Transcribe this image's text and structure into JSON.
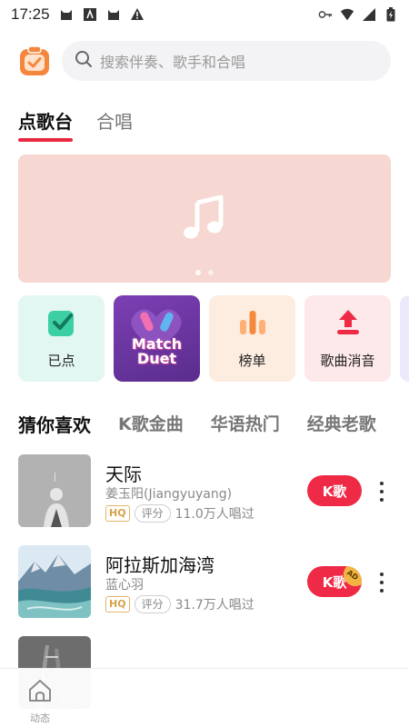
{
  "status_bar": {
    "time": "17:25",
    "left_icons": [
      "cat-icon",
      "app-a-icon",
      "cat-icon",
      "warning-icon"
    ],
    "right_icons": [
      "key-icon",
      "wifi-icon",
      "signal-icon",
      "battery-icon"
    ]
  },
  "header": {
    "search_placeholder": "搜索伴奏、歌手和合唱"
  },
  "main_tabs": [
    {
      "label": "点歌台",
      "active": true
    },
    {
      "label": "合唱",
      "active": false
    }
  ],
  "banner": {
    "icon": "music-note-icon",
    "dots": 2,
    "active_dot": 0
  },
  "quick_entries": [
    {
      "label": "已点",
      "icon": "check-icon",
      "bg": "#e3f7f2"
    },
    {
      "label": "Match Duet",
      "icon": "microphone-duet-icon",
      "bg": "#6b3aa3"
    },
    {
      "label": "榜单",
      "icon": "bar-chart-icon",
      "bg": "#fdece0"
    },
    {
      "label": "歌曲消音",
      "icon": "upload-icon",
      "bg": "#fde8ea"
    }
  ],
  "match_duet": {
    "line1": "Match",
    "line2": "Duet"
  },
  "category_tabs": [
    {
      "label": "猜你喜欢",
      "active": true
    },
    {
      "label": "K歌金曲",
      "active": false
    },
    {
      "label": "华语热门",
      "active": false
    },
    {
      "label": "经典老歌",
      "active": false
    }
  ],
  "songs": [
    {
      "title": "天际",
      "artist": "姜玉阳(Jiangyuyang)",
      "hq": "HQ",
      "rate": "评分",
      "count": "11.0万人唱过",
      "button": "K歌",
      "ad": ""
    },
    {
      "title": "阿拉斯加海湾",
      "artist": "蓝心羽",
      "hq": "HQ",
      "rate": "评分",
      "count": "31.7万人唱过",
      "button": "K歌",
      "ad": "AD"
    }
  ],
  "bottom_nav": {
    "items": [
      {
        "label": "动态",
        "icon": "home-icon"
      }
    ]
  },
  "colors": {
    "accent": "#e8293f",
    "k_button": "#ee2a46",
    "banner_bg": "#f7d7d1",
    "search_bg": "#f3f3f5"
  }
}
